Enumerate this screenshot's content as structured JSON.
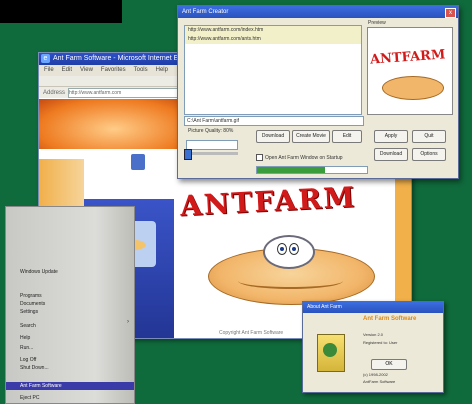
{
  "browser": {
    "title": "Ant Farm Software - Microsoft Internet Explorer",
    "menu": [
      "File",
      "Edit",
      "View",
      "Favorites",
      "Tools",
      "Help"
    ],
    "address_label": "Address",
    "address_value": "http://www.antfarm.com",
    "footer": "Copyright Ant Farm Software"
  },
  "cartoon": {
    "headline": "ANTFARM"
  },
  "dialog": {
    "title": "Ant Farm Creator",
    "list_rows": [
      "http://www.antfarm.com/index.htm",
      "http://www.antfarm.com/ants.htm",
      ""
    ],
    "preview_label": "Preview",
    "preview_text": "ANTFARM",
    "field_value": "C:\\Ant Farm\\antfarm.gif",
    "info": "Picture Quality: 80%",
    "buttons": [
      "Download",
      "Create Movie",
      "Edit",
      "Apply",
      "Quit",
      "Download",
      "Options"
    ],
    "checkbox": "Open Ant Farm Window on Startup",
    "progress": 0.62
  },
  "start_menu": {
    "items": [
      "Windows Update",
      "Programs",
      "Documents",
      "Settings",
      "Search",
      "Help",
      "Run...",
      "Log Off",
      "Shut Down..."
    ],
    "highlight": "Ant Farm Software",
    "last": "Eject PC"
  },
  "about": {
    "title": "About Ant Farm",
    "header": "Ant Farm Software",
    "lines": [
      "Version 2.0",
      "Registered to: User",
      "(c) 1998-2002",
      "AntFarm Software"
    ],
    "ok": "OK"
  }
}
